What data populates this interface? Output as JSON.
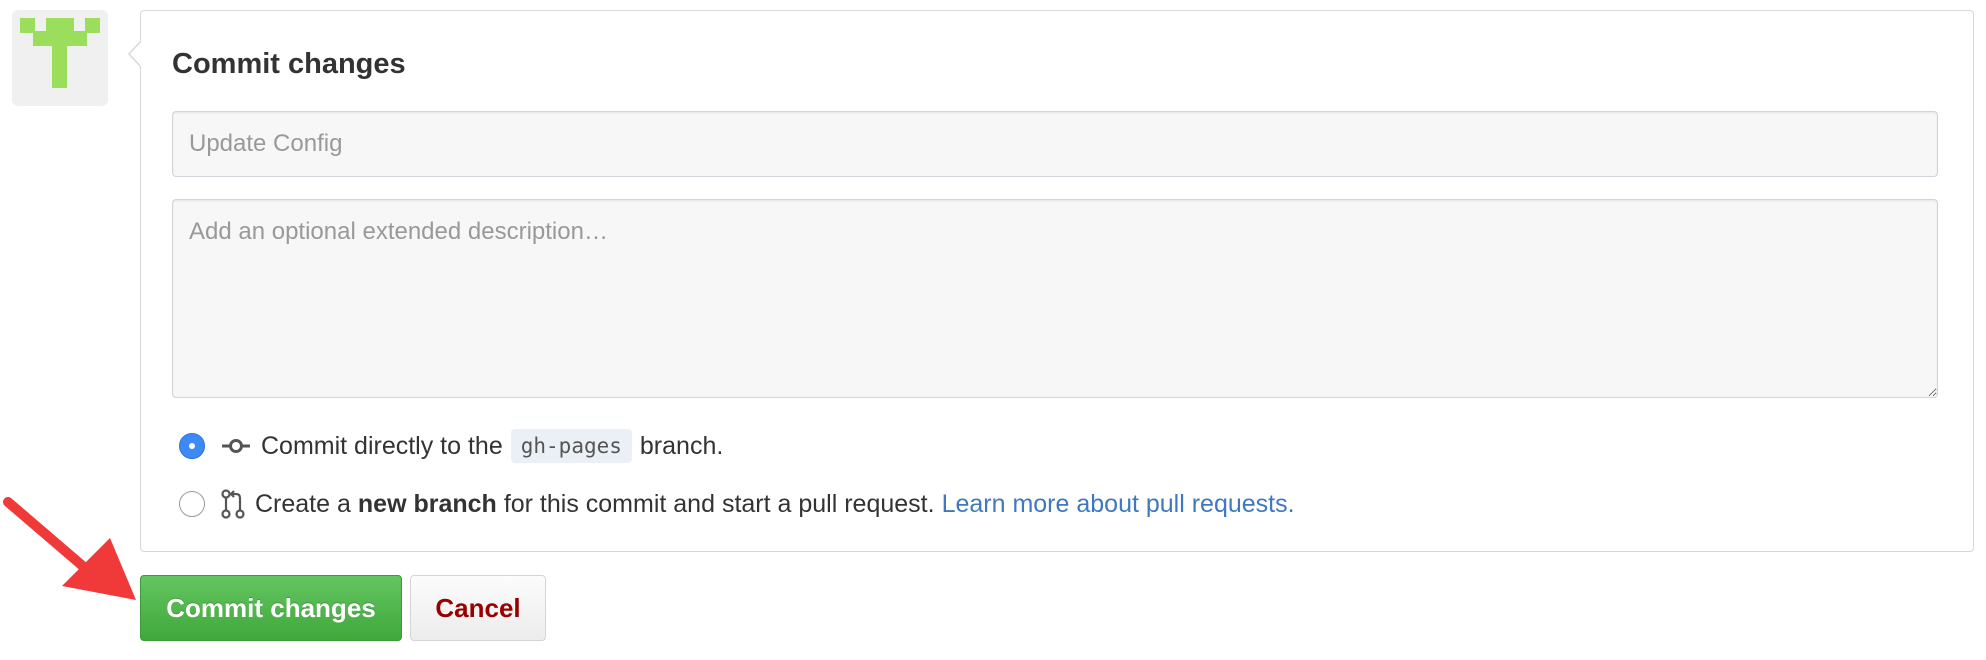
{
  "commit_form": {
    "title": "Commit changes",
    "summary_placeholder": "Update Config",
    "description_placeholder": "Add an optional extended description…",
    "options": [
      {
        "checked": true,
        "icon": "git-commit-icon",
        "text_before": "Commit directly to the",
        "branch": "gh-pages",
        "text_after": "branch."
      },
      {
        "checked": false,
        "icon": "git-pull-request-icon",
        "text_before": "Create a",
        "bold": "new branch",
        "text_after": "for this commit and start a pull request.",
        "link": "Learn more about pull requests."
      }
    ]
  },
  "actions": {
    "commit_label": "Commit changes",
    "cancel_label": "Cancel"
  },
  "colors": {
    "primary_green": "#3fa83b",
    "cancel_red": "#980000",
    "link_blue": "#4078c0",
    "radio_blue": "#3d8af7",
    "avatar_green": "#9bde5c"
  }
}
